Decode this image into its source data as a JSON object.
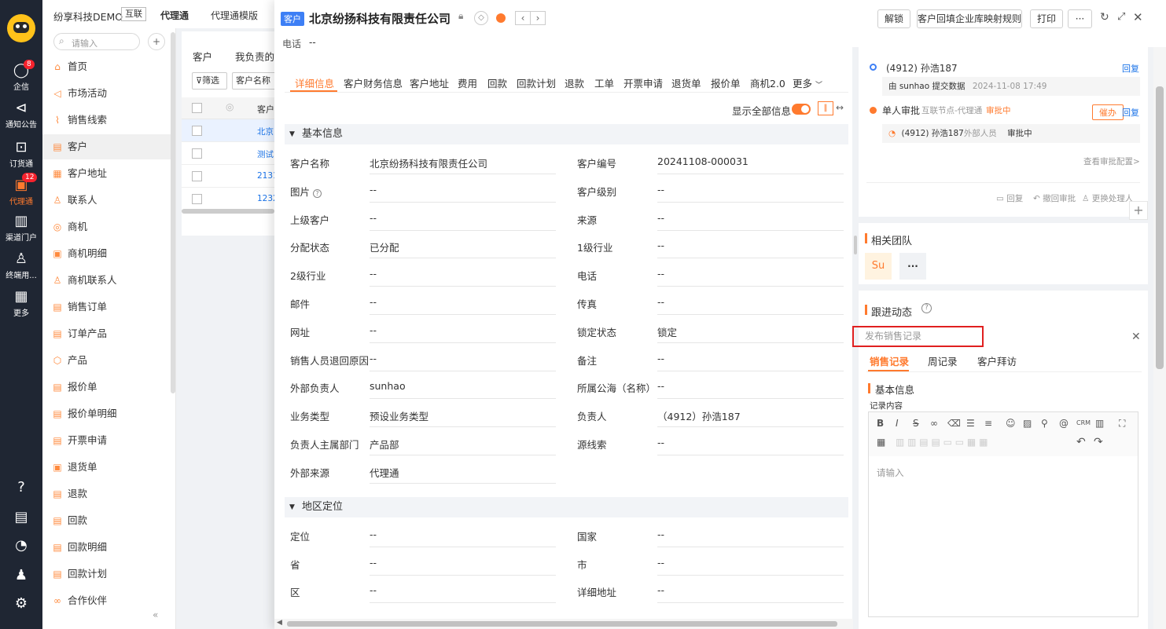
{
  "rail": {
    "items": [
      {
        "label": "企信",
        "badge": "8"
      },
      {
        "label": "通知公告"
      },
      {
        "label": "订货通"
      },
      {
        "label": "代理通",
        "badge": "12"
      },
      {
        "label": "渠道门户"
      },
      {
        "label": "终端用..."
      },
      {
        "label": "更多"
      }
    ]
  },
  "header": {
    "company": "纷享科技DEMO",
    "tag": "互联",
    "tab_active": "代理通",
    "tab_other": "代理通模版"
  },
  "nav": {
    "search_placeholder": "请输入",
    "items": [
      "首页",
      "市场活动",
      "销售线索",
      "客户",
      "客户地址",
      "联系人",
      "商机",
      "商机明细",
      "商机联系人",
      "销售订单",
      "订单产品",
      "产品",
      "报价单",
      "报价单明细",
      "开票申请",
      "退货单",
      "退款",
      "回款",
      "回款明细",
      "回款计划",
      "合作伙伴"
    ],
    "active": "客户"
  },
  "list": {
    "tab1": "客户",
    "tab2": "我负责的",
    "filter": "筛选",
    "col": "客户名称",
    "head": "客户",
    "rows": [
      "北京",
      "测试",
      "2131",
      "1232"
    ]
  },
  "modal": {
    "tag": "客户",
    "title": "北京纷扬科技有限责任公司",
    "phone_label": "电话",
    "phone_value": "--",
    "buttons": {
      "unlock": "解锁",
      "map_rule": "客户回填企业库映射规则",
      "print": "打印",
      "more": "···"
    },
    "tabs": [
      "详细信息",
      "客户财务信息",
      "客户地址",
      "费用",
      "回款",
      "回款计划",
      "退款",
      "工单",
      "开票申请",
      "退货单",
      "报价单",
      "商机2.0",
      "更多"
    ],
    "show_all": "显示全部信息",
    "section1": "基本信息",
    "left_fields": [
      {
        "label": "客户名称",
        "value": "北京纷扬科技有限责任公司"
      },
      {
        "label": "图片",
        "value": "--"
      },
      {
        "label": "上级客户",
        "value": "--"
      },
      {
        "label": "分配状态",
        "value": "已分配"
      },
      {
        "label": "2级行业",
        "value": "--"
      },
      {
        "label": "邮件",
        "value": "--"
      },
      {
        "label": "网址",
        "value": "--"
      },
      {
        "label": "销售人员退回原因",
        "value": "--"
      },
      {
        "label": "外部负责人",
        "value": "sunhao"
      },
      {
        "label": "业务类型",
        "value": "预设业务类型"
      },
      {
        "label": "负责人主属部门",
        "value": "产品部"
      },
      {
        "label": "外部来源",
        "value": "代理通"
      }
    ],
    "right_fields": [
      {
        "label": "客户编号",
        "value": "20241108-000031"
      },
      {
        "label": "客户级别",
        "value": "--"
      },
      {
        "label": "来源",
        "value": "--"
      },
      {
        "label": "1级行业",
        "value": "--"
      },
      {
        "label": "电话",
        "value": "--"
      },
      {
        "label": "传真",
        "value": "--"
      },
      {
        "label": "锁定状态",
        "value": "锁定"
      },
      {
        "label": "备注",
        "value": "--"
      },
      {
        "label": "所属公海（名称）",
        "value": "--"
      },
      {
        "label": "负责人",
        "value": "（4912）孙浩187"
      },
      {
        "label": "源线索",
        "value": "--"
      }
    ],
    "section2": "地区定位",
    "region_left": [
      {
        "label": "定位",
        "value": "--"
      },
      {
        "label": "省",
        "value": "--"
      },
      {
        "label": "区",
        "value": "--"
      }
    ],
    "region_right": [
      {
        "label": "国家",
        "value": "--"
      },
      {
        "label": "市",
        "value": "--"
      },
      {
        "label": "详细地址",
        "value": "--"
      }
    ]
  },
  "approval": {
    "user": "(4912) 孙浩187",
    "reply": "回复",
    "submit": "由 sunhao 提交数据",
    "submit_time": "2024-11-08 17:49",
    "step": "单人审批",
    "step_node": "互联节点-代理通",
    "step_status": "审批中",
    "urge": "催办",
    "reply2": "回复",
    "approver": "(4912) 孙浩187",
    "approver_tag": "外部人员",
    "approver_status": "审批中",
    "view_config": "查看审批配置>",
    "actions": [
      "回复",
      "撤回审批",
      "更换处理人"
    ]
  },
  "team": {
    "title": "相关团队",
    "avatar": "Su",
    "more": "···"
  },
  "follow": {
    "title": "跟进动态",
    "input_placeholder": "发布销售记录",
    "tabs": [
      "销售记录",
      "周记录",
      "客户拜访"
    ],
    "section": "基本信息",
    "content_label": "记录内容",
    "editor_placeholder": "请输入"
  },
  "colors": {
    "accent": "#ff7a2e",
    "rail": "#1f2633",
    "blue": "#1a73e8",
    "red_box": "#e02020"
  }
}
